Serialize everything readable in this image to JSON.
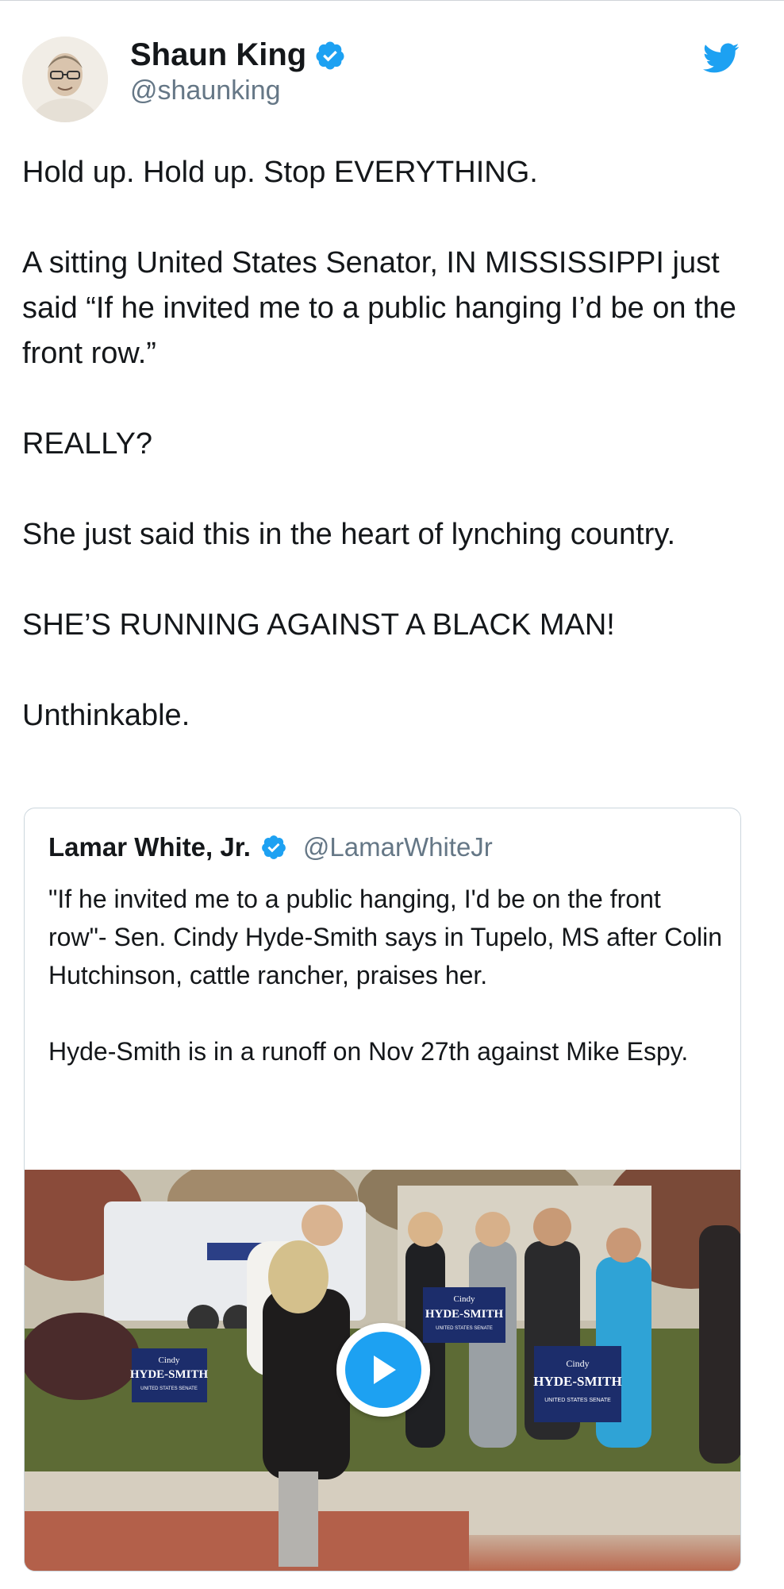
{
  "tweet": {
    "author_name": "Shaun King",
    "author_handle": "@shaunking",
    "paragraphs": [
      "Hold up. Hold up. Stop EVERYTHING.",
      "A sitting United States Senator, IN MISSISSIPPI just said “If he invited me to a public hanging I’d be on the front row.”",
      "REALLY?",
      "She just said this in the heart of lynching country.",
      "SHE’S RUNNING AGAINST A BLACK MAN!",
      "Unthinkable."
    ]
  },
  "quoted_tweet": {
    "author_name": "Lamar White, Jr.",
    "author_handle": "@LamarWhiteJr",
    "paragraphs": [
      "\"If he invited me to a public hanging, I'd be on the front row\"- Sen. Cindy Hyde-Smith says in Tupelo, MS after Colin Hutchinson, cattle rancher, praises her.",
      "Hyde-Smith is in a runoff on Nov 27th against Mike Espy."
    ],
    "video_signs": [
      {
        "line1": "Cindy",
        "line2": "HYDE-SMITH",
        "line3": "UNITED STATES SENATE"
      },
      {
        "line1": "Cindy",
        "line2": "HYDE-SMITH",
        "line3": "UNITED STATES SENATE"
      },
      {
        "line1": "Cindy",
        "line2": "HYDE-SMITH",
        "line3": "UNITED STATES SENATE"
      }
    ]
  },
  "colors": {
    "twitter_blue": "#1da1f2",
    "text_primary": "#14171a",
    "text_secondary": "#657786",
    "border": "#ccd6dd",
    "sign_navy": "#1c2d6b"
  },
  "icons": {
    "verified": "verified-badge-icon",
    "brand": "twitter-bird-icon",
    "play": "play-icon"
  }
}
